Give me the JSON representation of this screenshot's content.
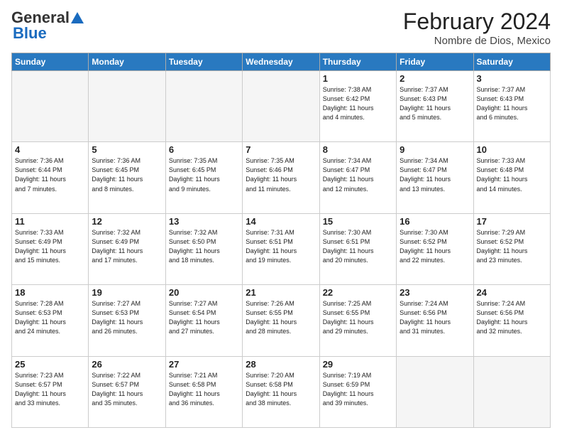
{
  "header": {
    "logo_general": "General",
    "logo_blue": "Blue",
    "title": "February 2024",
    "subtitle": "Nombre de Dios, Mexico"
  },
  "columns": [
    "Sunday",
    "Monday",
    "Tuesday",
    "Wednesday",
    "Thursday",
    "Friday",
    "Saturday"
  ],
  "weeks": [
    [
      {
        "day": "",
        "info": ""
      },
      {
        "day": "",
        "info": ""
      },
      {
        "day": "",
        "info": ""
      },
      {
        "day": "",
        "info": ""
      },
      {
        "day": "1",
        "info": "Sunrise: 7:38 AM\nSunset: 6:42 PM\nDaylight: 11 hours\nand 4 minutes."
      },
      {
        "day": "2",
        "info": "Sunrise: 7:37 AM\nSunset: 6:43 PM\nDaylight: 11 hours\nand 5 minutes."
      },
      {
        "day": "3",
        "info": "Sunrise: 7:37 AM\nSunset: 6:43 PM\nDaylight: 11 hours\nand 6 minutes."
      }
    ],
    [
      {
        "day": "4",
        "info": "Sunrise: 7:36 AM\nSunset: 6:44 PM\nDaylight: 11 hours\nand 7 minutes."
      },
      {
        "day": "5",
        "info": "Sunrise: 7:36 AM\nSunset: 6:45 PM\nDaylight: 11 hours\nand 8 minutes."
      },
      {
        "day": "6",
        "info": "Sunrise: 7:35 AM\nSunset: 6:45 PM\nDaylight: 11 hours\nand 9 minutes."
      },
      {
        "day": "7",
        "info": "Sunrise: 7:35 AM\nSunset: 6:46 PM\nDaylight: 11 hours\nand 11 minutes."
      },
      {
        "day": "8",
        "info": "Sunrise: 7:34 AM\nSunset: 6:47 PM\nDaylight: 11 hours\nand 12 minutes."
      },
      {
        "day": "9",
        "info": "Sunrise: 7:34 AM\nSunset: 6:47 PM\nDaylight: 11 hours\nand 13 minutes."
      },
      {
        "day": "10",
        "info": "Sunrise: 7:33 AM\nSunset: 6:48 PM\nDaylight: 11 hours\nand 14 minutes."
      }
    ],
    [
      {
        "day": "11",
        "info": "Sunrise: 7:33 AM\nSunset: 6:49 PM\nDaylight: 11 hours\nand 15 minutes."
      },
      {
        "day": "12",
        "info": "Sunrise: 7:32 AM\nSunset: 6:49 PM\nDaylight: 11 hours\nand 17 minutes."
      },
      {
        "day": "13",
        "info": "Sunrise: 7:32 AM\nSunset: 6:50 PM\nDaylight: 11 hours\nand 18 minutes."
      },
      {
        "day": "14",
        "info": "Sunrise: 7:31 AM\nSunset: 6:51 PM\nDaylight: 11 hours\nand 19 minutes."
      },
      {
        "day": "15",
        "info": "Sunrise: 7:30 AM\nSunset: 6:51 PM\nDaylight: 11 hours\nand 20 minutes."
      },
      {
        "day": "16",
        "info": "Sunrise: 7:30 AM\nSunset: 6:52 PM\nDaylight: 11 hours\nand 22 minutes."
      },
      {
        "day": "17",
        "info": "Sunrise: 7:29 AM\nSunset: 6:52 PM\nDaylight: 11 hours\nand 23 minutes."
      }
    ],
    [
      {
        "day": "18",
        "info": "Sunrise: 7:28 AM\nSunset: 6:53 PM\nDaylight: 11 hours\nand 24 minutes."
      },
      {
        "day": "19",
        "info": "Sunrise: 7:27 AM\nSunset: 6:53 PM\nDaylight: 11 hours\nand 26 minutes."
      },
      {
        "day": "20",
        "info": "Sunrise: 7:27 AM\nSunset: 6:54 PM\nDaylight: 11 hours\nand 27 minutes."
      },
      {
        "day": "21",
        "info": "Sunrise: 7:26 AM\nSunset: 6:55 PM\nDaylight: 11 hours\nand 28 minutes."
      },
      {
        "day": "22",
        "info": "Sunrise: 7:25 AM\nSunset: 6:55 PM\nDaylight: 11 hours\nand 29 minutes."
      },
      {
        "day": "23",
        "info": "Sunrise: 7:24 AM\nSunset: 6:56 PM\nDaylight: 11 hours\nand 31 minutes."
      },
      {
        "day": "24",
        "info": "Sunrise: 7:24 AM\nSunset: 6:56 PM\nDaylight: 11 hours\nand 32 minutes."
      }
    ],
    [
      {
        "day": "25",
        "info": "Sunrise: 7:23 AM\nSunset: 6:57 PM\nDaylight: 11 hours\nand 33 minutes."
      },
      {
        "day": "26",
        "info": "Sunrise: 7:22 AM\nSunset: 6:57 PM\nDaylight: 11 hours\nand 35 minutes."
      },
      {
        "day": "27",
        "info": "Sunrise: 7:21 AM\nSunset: 6:58 PM\nDaylight: 11 hours\nand 36 minutes."
      },
      {
        "day": "28",
        "info": "Sunrise: 7:20 AM\nSunset: 6:58 PM\nDaylight: 11 hours\nand 38 minutes."
      },
      {
        "day": "29",
        "info": "Sunrise: 7:19 AM\nSunset: 6:59 PM\nDaylight: 11 hours\nand 39 minutes."
      },
      {
        "day": "",
        "info": ""
      },
      {
        "day": "",
        "info": ""
      }
    ]
  ]
}
